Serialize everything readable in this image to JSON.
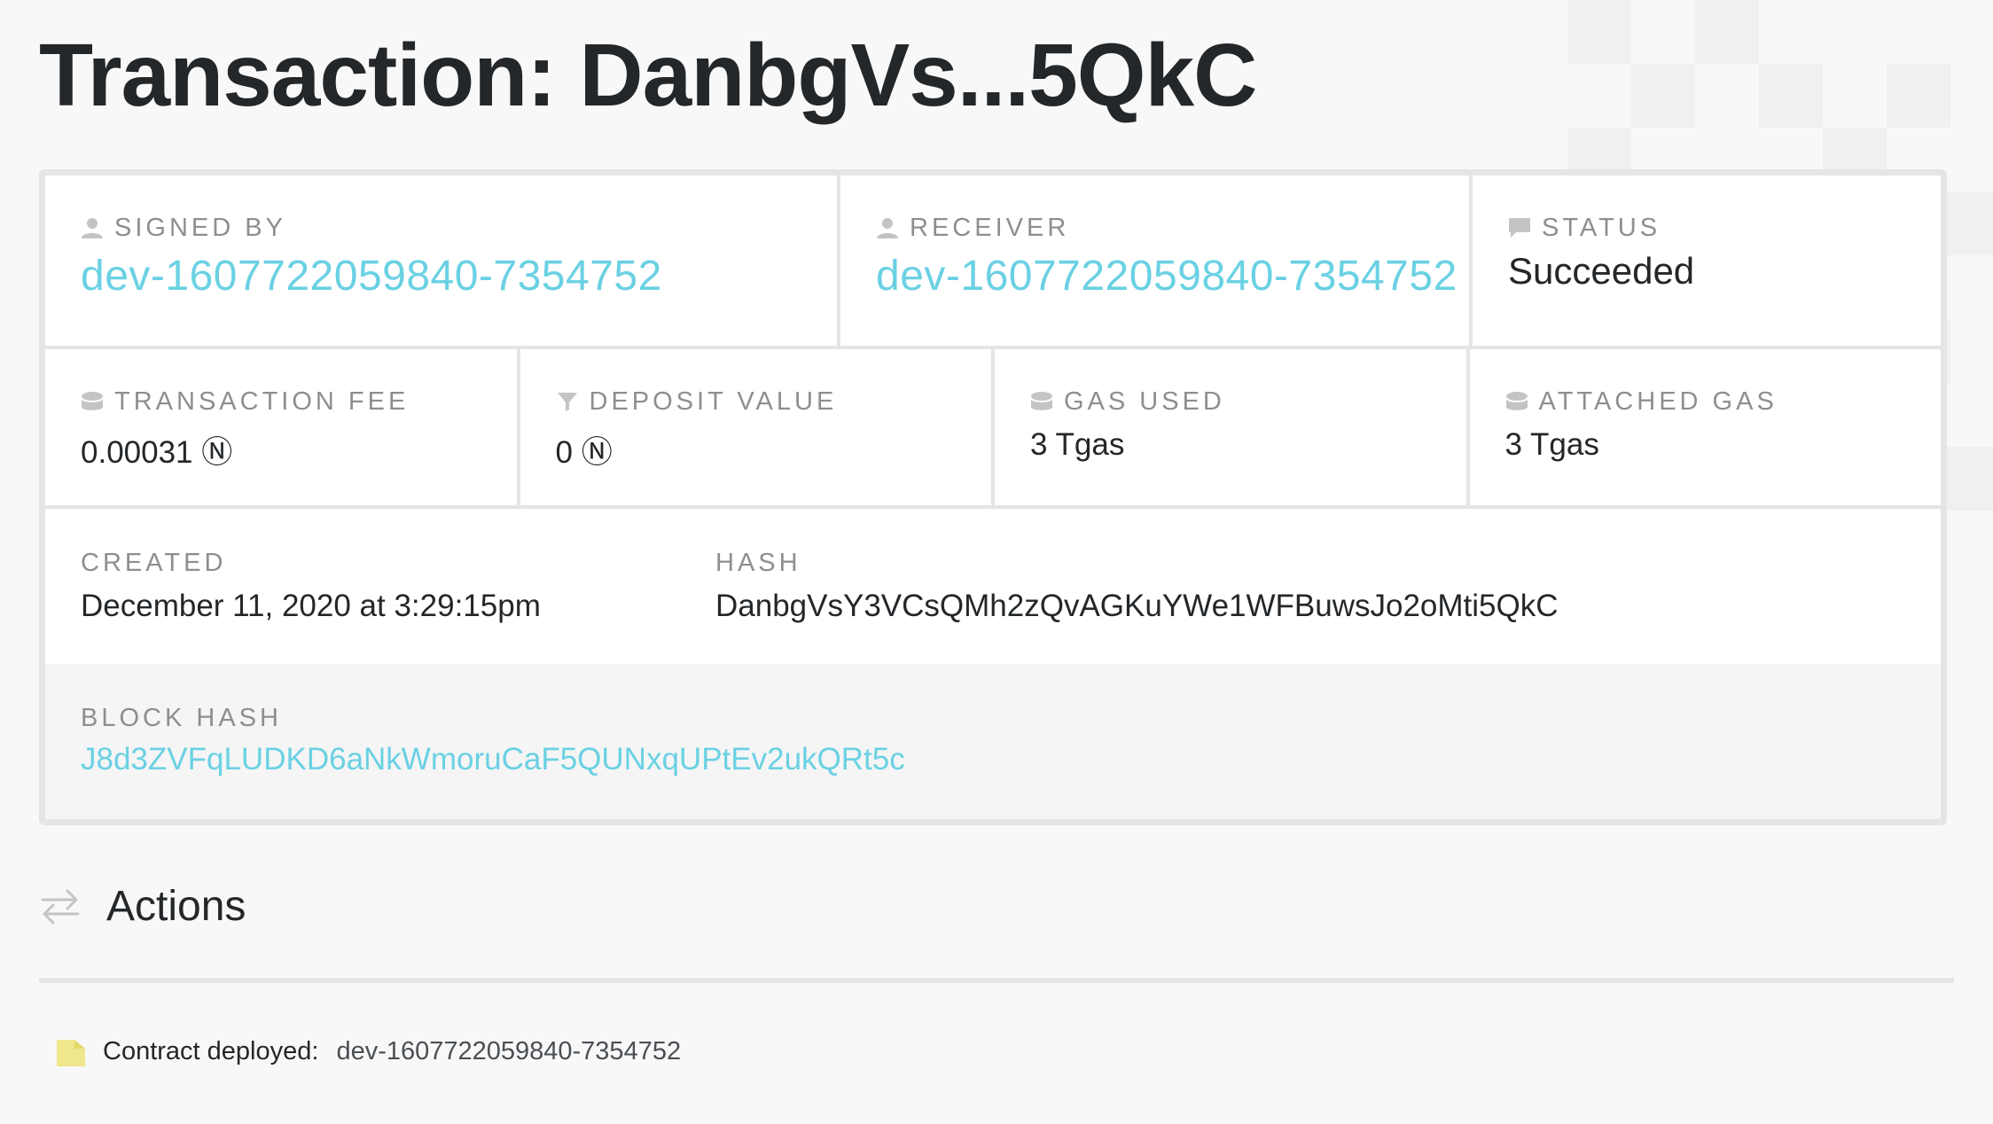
{
  "page": {
    "title": "Transaction: DanbgVs...5QkC"
  },
  "transaction": {
    "signed_by": {
      "label": "SIGNED BY",
      "value": "dev-1607722059840-7354752",
      "icon": "user-icon"
    },
    "receiver": {
      "label": "RECEIVER",
      "value": "dev-1607722059840-7354752",
      "icon": "user-icon"
    },
    "status": {
      "label": "STATUS",
      "value": "Succeeded",
      "icon": "comment-icon"
    },
    "transaction_fee": {
      "label": "TRANSACTION FEE",
      "value": "0.00031 Ⓝ",
      "icon": "coins-icon"
    },
    "deposit_value": {
      "label": "DEPOSIT VALUE",
      "value": "0 Ⓝ",
      "icon": "filter-icon"
    },
    "gas_used": {
      "label": "GAS USED",
      "value": "3 Tgas",
      "icon": "coins-icon"
    },
    "attached_gas": {
      "label": "ATTACHED GAS",
      "value": "3 Tgas",
      "icon": "coins-icon"
    },
    "created": {
      "label": "CREATED",
      "value": "December 11, 2020 at 3:29:15pm"
    },
    "hash": {
      "label": "HASH",
      "value": "DanbgVsY3VCsQMh2zQvAGKuYWe1WFBuwsJo2oMti5QkC"
    },
    "block_hash": {
      "label": "BLOCK HASH",
      "value": "J8d3ZVFqLUDKD6aNkWmoruCaF5QUNxqUPtEv2ukQRt5c"
    }
  },
  "actions": {
    "title": "Actions",
    "icon": "transfer-arrows-icon",
    "items": [
      {
        "label": "Contract deployed:",
        "value": "dev-1607722059840-7354752",
        "icon": "file-icon"
      }
    ]
  },
  "colors": {
    "link": "#6ad1e3",
    "text": "#24272a",
    "label": "#8e8e8e",
    "border": "#e5e5e5",
    "action_icon": "#f0e68c"
  }
}
